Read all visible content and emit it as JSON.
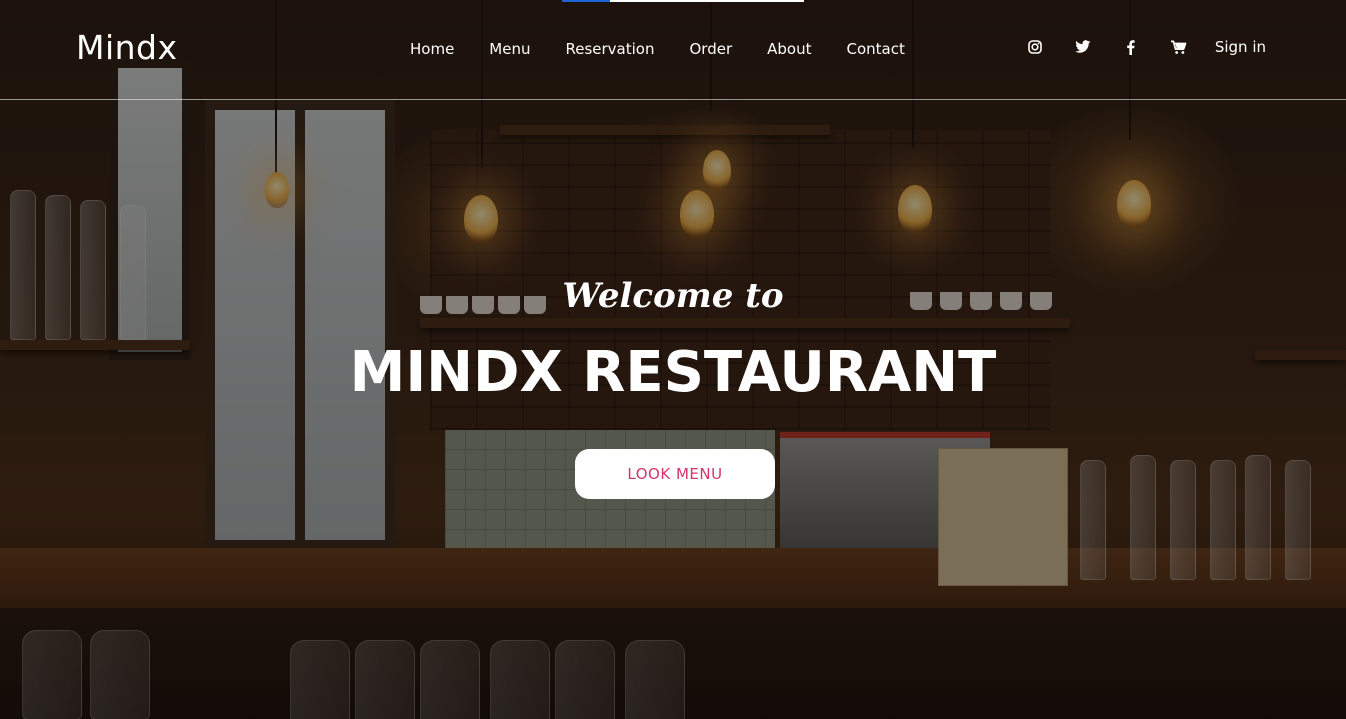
{
  "navbar": {
    "brand": "Mindx",
    "links": [
      {
        "label": "Home"
      },
      {
        "label": "Menu"
      },
      {
        "label": "Reservation"
      },
      {
        "label": "Order"
      },
      {
        "label": "About"
      },
      {
        "label": "Contact"
      }
    ],
    "icons": [
      "instagram-icon",
      "twitter-icon",
      "facebook-icon",
      "cart-icon"
    ],
    "signin": "Sign in"
  },
  "hero": {
    "welcome": "Welcome to",
    "headline": "MINDX RESTAURANT",
    "cta": "LOOK MENU"
  },
  "colors": {
    "cta_text": "#d6336c",
    "top_progress": "#1e63d6"
  }
}
